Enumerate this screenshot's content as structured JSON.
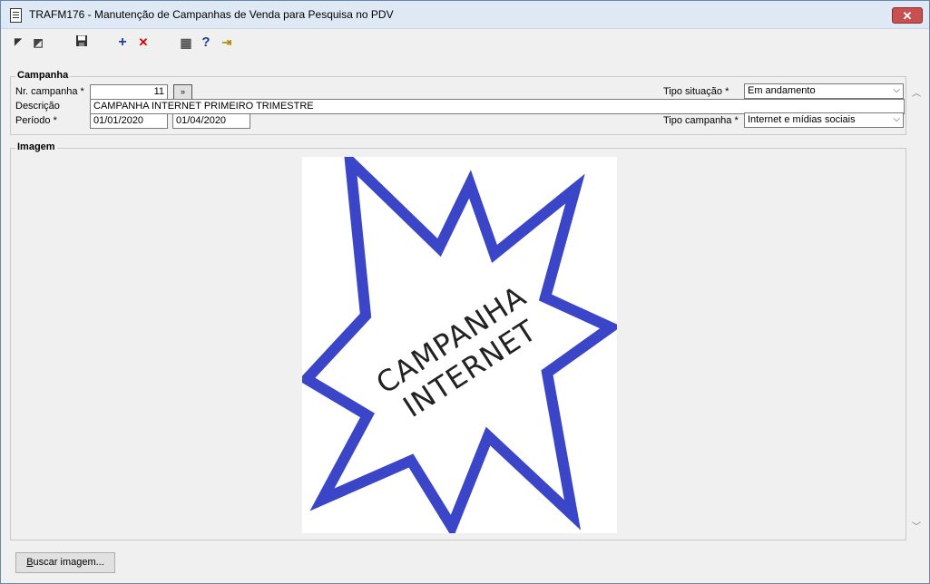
{
  "window": {
    "title": "TRAFM176 - Manutenção de Campanhas de Venda para Pesquisa no PDV",
    "close_label": "✕"
  },
  "toolbar": {
    "items": [
      {
        "icon": "first-record-icon",
        "glyph": "◤"
      },
      {
        "icon": "last-record-icon",
        "glyph": "◩"
      },
      {
        "icon": "save-icon",
        "glyph": "💾"
      },
      {
        "icon": "add-icon",
        "glyph": "+"
      },
      {
        "icon": "delete-icon",
        "glyph": "✕"
      },
      {
        "icon": "calendar-icon",
        "glyph": "▦"
      },
      {
        "icon": "help-icon",
        "glyph": "?"
      },
      {
        "icon": "exit-icon",
        "glyph": "⇥"
      }
    ]
  },
  "campanha": {
    "legend": "Campanha",
    "nr_label": "Nr. campanha *",
    "nr_value": "11",
    "lookup_glyph": "»",
    "descricao_label": "Descrição",
    "descricao_value": "CAMPANHA INTERNET PRIMEIRO TRIMESTRE",
    "periodo_label": "Período *",
    "periodo_inicio": "01/01/2020",
    "periodo_fim": "01/04/2020",
    "tipo_situacao_label": "Tipo situação *",
    "tipo_situacao_value": "Em andamento",
    "tipo_campanha_label": "Tipo campanha *",
    "tipo_campanha_value": "Internet e mídias sociais"
  },
  "imagem": {
    "legend": "Imagem",
    "text_line1": "CAMPANHA",
    "text_line2": "INTERNET"
  },
  "buttons": {
    "buscar_first": "B",
    "buscar_rest": "uscar imagem..."
  },
  "colors": {
    "star_stroke": "#3a45c7",
    "delete_red": "#d40000",
    "add_blue": "#1f3fa0"
  }
}
